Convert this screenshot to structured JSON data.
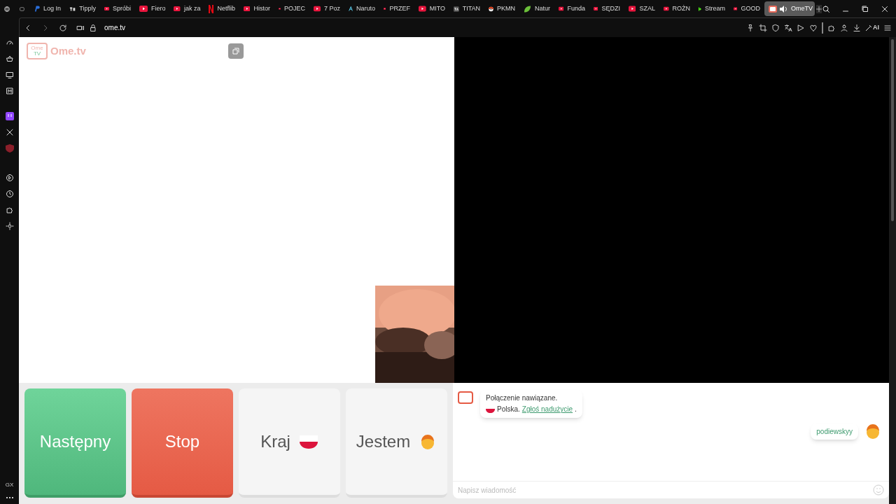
{
  "browser_tabs": [
    {
      "label": "Log In",
      "kind": "paypal",
      "selected": false
    },
    {
      "label": "Tipply",
      "kind": "tipply",
      "selected": false
    },
    {
      "label": "Spróbi",
      "kind": "youtube",
      "selected": false
    },
    {
      "label": "Fiero",
      "kind": "youtube",
      "selected": false
    },
    {
      "label": "jak za",
      "kind": "youtube",
      "selected": false
    },
    {
      "label": "Netflib",
      "kind": "netflix",
      "selected": false
    },
    {
      "label": "Histor",
      "kind": "youtube",
      "selected": false
    },
    {
      "label": "POJEC",
      "kind": "youtube",
      "selected": false
    },
    {
      "label": "7 Poz",
      "kind": "youtube",
      "selected": false
    },
    {
      "label": "Naruto",
      "kind": "letter",
      "selected": false
    },
    {
      "label": "PRZEF",
      "kind": "youtube",
      "selected": false
    },
    {
      "label": "MITO",
      "kind": "youtube",
      "selected": false
    },
    {
      "label": "TITAN",
      "kind": "square",
      "selected": false
    },
    {
      "label": "PKMN",
      "kind": "ball",
      "selected": false
    },
    {
      "label": "Natur",
      "kind": "leaf",
      "selected": false
    },
    {
      "label": "Funda",
      "kind": "youtube",
      "selected": false
    },
    {
      "label": "SĘDZI",
      "kind": "youtube",
      "selected": false
    },
    {
      "label": "SZAL",
      "kind": "youtube",
      "selected": false
    },
    {
      "label": "ROŻN",
      "kind": "youtube",
      "selected": false
    },
    {
      "label": "Stream",
      "kind": "kick",
      "selected": false
    },
    {
      "label": "GOOD",
      "kind": "youtube",
      "selected": false
    },
    {
      "label": "OmeTV",
      "kind": "ometv",
      "selected": true
    }
  ],
  "address_bar": {
    "url": "ome.tv"
  },
  "ai_button": "AI",
  "sidebar_footer": "GX",
  "site": {
    "logo": "Ome.tv",
    "logo_badge_top": "Ome",
    "logo_badge_bottom": "TV"
  },
  "controls": [
    {
      "label": "Następny",
      "kind": "next"
    },
    {
      "label": "Stop",
      "kind": "stop"
    },
    {
      "label": "Kraj",
      "kind": "country"
    },
    {
      "label": "Jestem",
      "kind": "gender"
    }
  ],
  "chat": {
    "system_message": {
      "line1": "Połączenie nawiązane.",
      "country": "Polska.",
      "report_link": "Zgłoś nadużycie",
      "end": "."
    },
    "user_message": "podiewskyy",
    "input": {
      "placeholder": "Napisz wiadomość"
    }
  }
}
